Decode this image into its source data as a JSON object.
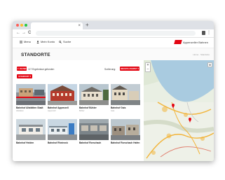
{
  "browser": {
    "tab_close": "×",
    "new_tab": "+",
    "back": "←",
    "forward": "→",
    "reload": "C",
    "menu": "⋮"
  },
  "header": {
    "menu_label": "Menu",
    "login_label": "Mein Konto",
    "search_label": "Suche",
    "brand_name": "Appenzeller Bahnen"
  },
  "page": {
    "title": "STANDORTE",
    "breadcrumb": "Home · Standorte"
  },
  "toolbar": {
    "filter_label": "▼ FILTER",
    "results_text": "117 Ergebnisse gefunden",
    "sort_label": "Sortierung:",
    "sort_value": "NEUSTE ZUERST ▾",
    "secondary_button": "STANDORT ▾"
  },
  "stations": [
    {
      "name": "Bahnhof Altstätten Stadt",
      "sub": "Altstätten"
    },
    {
      "name": "Bahnhof Appenzell",
      "sub": "Appenzell"
    },
    {
      "name": "Bahnhof Bühler",
      "sub": "Bühler"
    },
    {
      "name": "Bahnhof Gais",
      "sub": "Gais"
    },
    {
      "name": "Bahnhof Heiden",
      "sub": ""
    },
    {
      "name": "Bahnhof Rheineck",
      "sub": ""
    },
    {
      "name": "Bahnhof Rorschach",
      "sub": ""
    },
    {
      "name": "Bahnhof Rorschach Hafen",
      "sub": ""
    }
  ],
  "map": {
    "zoom_in": "+",
    "zoom_out": "−",
    "layers": "⊕"
  },
  "colors": {
    "accent": "#e30613",
    "lake": "#a9cbe0",
    "land": "#e9efe3"
  }
}
